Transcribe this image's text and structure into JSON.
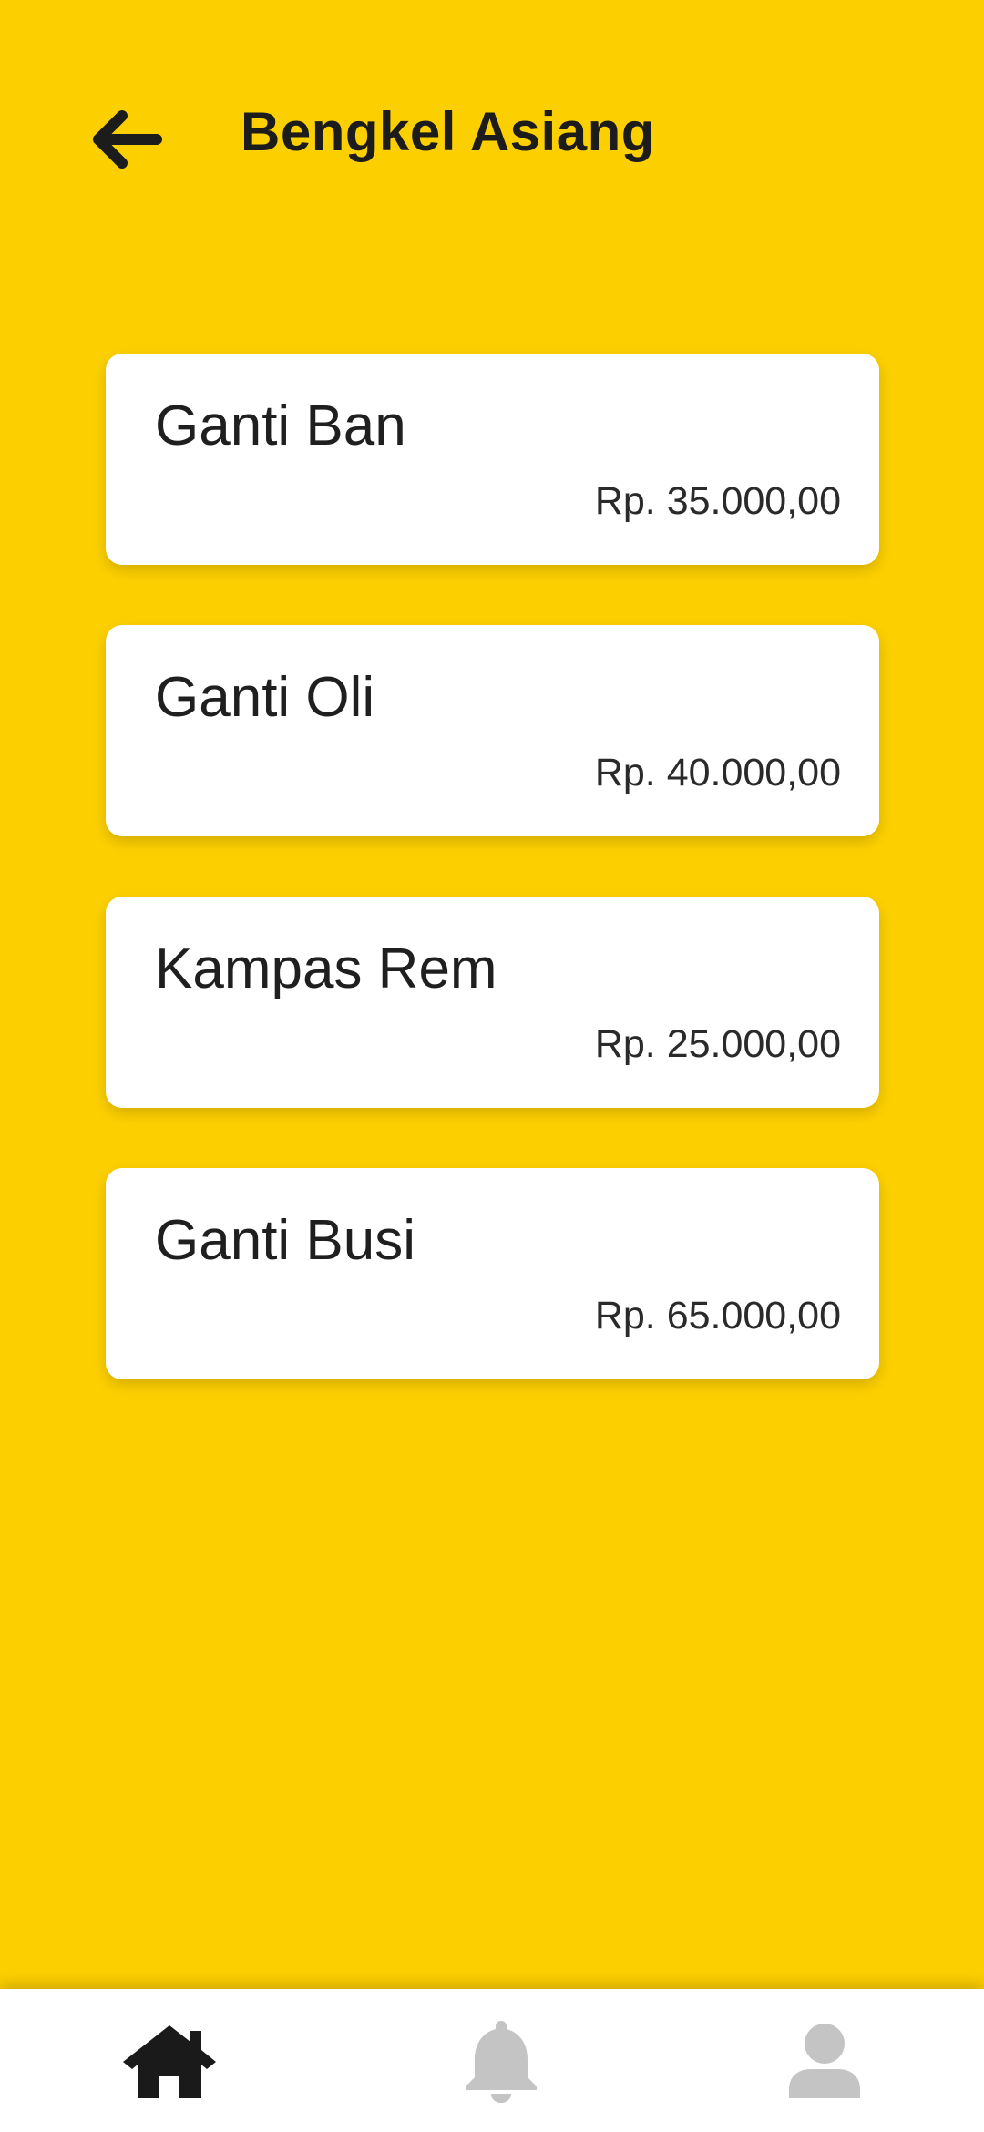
{
  "header": {
    "title": "Bengkel Asiang",
    "back_icon": "arrow-left-icon"
  },
  "services": [
    {
      "name": "Ganti Ban",
      "price": "Rp. 35.000,00"
    },
    {
      "name": "Ganti Oli",
      "price": "Rp. 40.000,00"
    },
    {
      "name": "Kampas Rem",
      "price": "Rp. 25.000,00"
    },
    {
      "name": "Ganti Busi",
      "price": "Rp. 65.000,00"
    }
  ],
  "bottom_nav": {
    "items": [
      {
        "icon": "home-icon",
        "active": true
      },
      {
        "icon": "bell-icon",
        "active": false
      },
      {
        "icon": "user-icon",
        "active": false
      }
    ]
  },
  "colors": {
    "background": "#FCD000",
    "card": "#FFFFFF",
    "text": "#1C1C1C",
    "nav_active": "#1A1A1A",
    "nav_inactive": "#C4C4C4"
  }
}
